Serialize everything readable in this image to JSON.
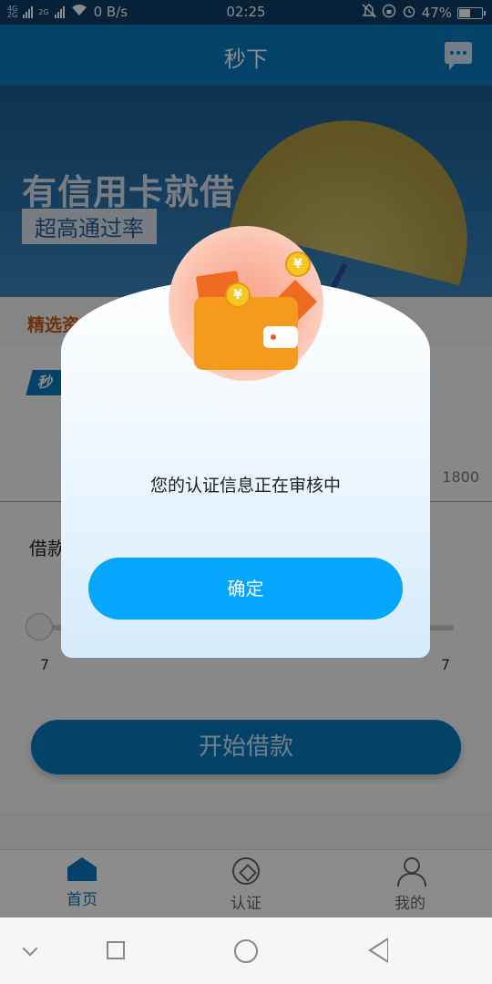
{
  "status_bar": {
    "net1": "4G",
    "net2": "2G",
    "net3": "2G",
    "speed": "0 B/s",
    "time": "02:25",
    "battery": "47%"
  },
  "header": {
    "title": "秒下"
  },
  "banner": {
    "headline": "有信用卡就借",
    "tag": "超高通过率"
  },
  "section": {
    "title": "精选资"
  },
  "badge": {
    "label": "秒"
  },
  "amount": {
    "max_label": "1800"
  },
  "loan": {
    "label": "借款",
    "min": "7",
    "max": "7"
  },
  "start_button": {
    "label": "开始借款"
  },
  "tabs": [
    {
      "label": "首页",
      "active": true
    },
    {
      "label": "认证",
      "active": false
    },
    {
      "label": "我的",
      "active": false
    }
  ],
  "dialog": {
    "message": "您的认证信息正在审核中",
    "confirm_label": "确定",
    "coin_symbol": "¥"
  },
  "colors": {
    "primary": "#0a78c2",
    "dialog_button": "#06a6fd",
    "accent_orange": "#c85c13"
  }
}
